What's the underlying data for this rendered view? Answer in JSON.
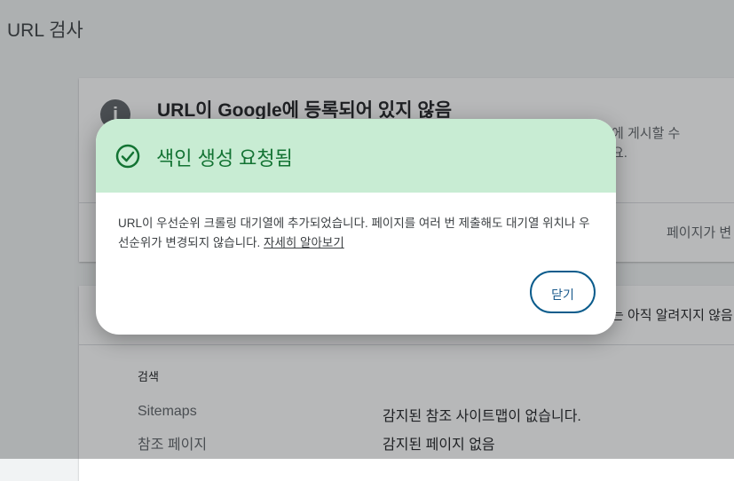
{
  "page": {
    "title": "URL 검사"
  },
  "status_card": {
    "title": "URL이 Google에 등록되어 있지 않음",
    "desc_line1": "에 게시할 수",
    "desc_line2": "요.",
    "right_text": "페이지가 변"
  },
  "coverage_card": {
    "right_text": "는 아직 알려지지 않음",
    "section_label": "검색",
    "rows": [
      {
        "key": "Sitemaps",
        "value": "감지된 참조 사이트맵이 없습니다."
      },
      {
        "key": "참조 페이지",
        "value": "감지된 페이지 없음"
      }
    ]
  },
  "dialog": {
    "title": "색인 생성 요청됨",
    "body": "URL이 우선순위 크롤링 대기열에 추가되었습니다. 페이지를 여러 번 제출해도 대기열 위치나 우선순위가 변경되지 않습니다. ",
    "link": "자세히 알아보기",
    "close_label": "닫기"
  },
  "colors": {
    "header_bg": "#c8ecd3",
    "title_green": "#137333",
    "button_border": "#0b5c8c"
  }
}
